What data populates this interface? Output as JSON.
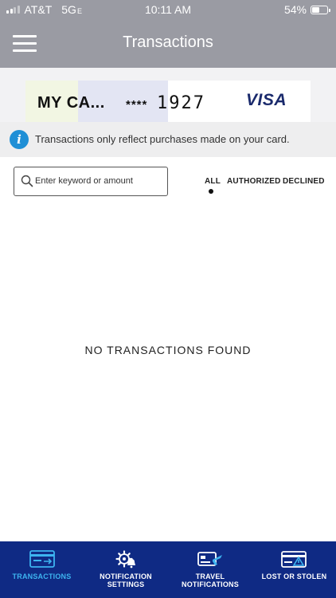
{
  "status_bar": {
    "carrier": "AT&T",
    "network": "5G",
    "network_suffix": "E",
    "time": "10:11 AM",
    "battery": "54%",
    "battery_level": 0.54
  },
  "header": {
    "title": "Transactions",
    "menu_icon": "hamburger-icon"
  },
  "card": {
    "name": "MY CA...",
    "mask": "****",
    "last4": "1927",
    "brand": "VISA"
  },
  "info": {
    "icon": "info-icon",
    "text": "Transactions only reflect purchases made on your card."
  },
  "search": {
    "placeholder": "Enter keyword or amount",
    "value": ""
  },
  "filters": {
    "selected": "ALL",
    "items": [
      {
        "label": "ALL"
      },
      {
        "label": "AUTHORIZED"
      },
      {
        "label": "DECLINED"
      }
    ]
  },
  "empty_state": "NO TRANSACTIONS FOUND",
  "tabbar": {
    "active": "TRANSACTIONS",
    "items": [
      {
        "line1": "TRANSACTIONS",
        "line2": "",
        "icon": "transactions-card-icon"
      },
      {
        "line1": "NOTIFICATION",
        "line2": "SETTINGS",
        "icon": "notification-settings-icon"
      },
      {
        "line1": "TRAVEL",
        "line2": "NOTIFICATIONS",
        "icon": "travel-notifications-icon"
      },
      {
        "line1": "LOST OR STOLEN",
        "line2": "",
        "icon": "lost-or-stolen-icon"
      }
    ]
  },
  "colors": {
    "header_bg": "#9a9ba3",
    "tabbar_bg": "#0f2a84",
    "tab_active": "#3db4f0",
    "info_icon": "#1f8fd6",
    "visa": "#1a2a6c"
  }
}
